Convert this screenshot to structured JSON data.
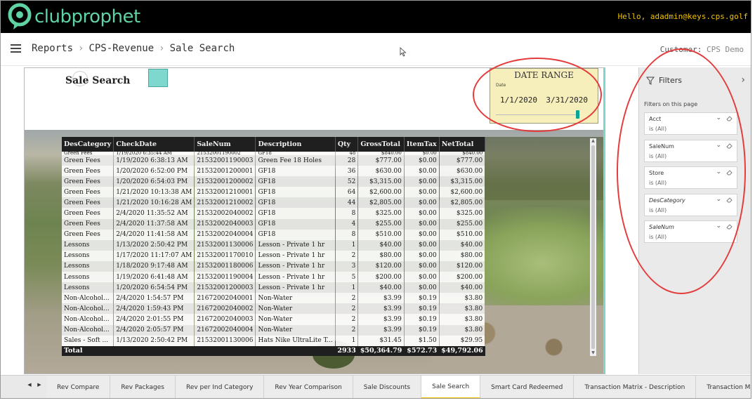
{
  "app": {
    "logo_text": "clubprophet",
    "greeting": "Hello, adadmin@keys.cps.golf",
    "brand_color": "#5fd3a3",
    "greeting_color": "#f2c200"
  },
  "nav": {
    "breadcrumbs": [
      "Reports",
      "CPS-Revenue",
      "Sale Search"
    ],
    "customer_label": "Customer:",
    "customer_value": "CPS Demo"
  },
  "report": {
    "title": "Sale Search",
    "date_slicer": {
      "title": "DATE RANGE",
      "label": "Date",
      "start": "1/1/2020",
      "end": "3/31/2020",
      "accent": "#0ba596"
    },
    "table": {
      "columns": [
        "DesCategory",
        "CheckDate",
        "SaleNum",
        "Description",
        "Qty",
        "GrossTotal",
        "ItemTax",
        "NetTotal"
      ],
      "partial_row": [
        "Green Fees",
        "1/19/2020 6:35:44 AM",
        "21532001190002",
        "GF18",
        "48",
        "$840.00",
        "$0.00",
        "$840.00"
      ],
      "rows": [
        [
          "Green Fees",
          "1/19/2020 6:38:13 AM",
          "21532001190003",
          "Green Fee 18 Holes",
          "28",
          "$777.00",
          "$0.00",
          "$777.00"
        ],
        [
          "Green Fees",
          "1/20/2020 6:52:00 PM",
          "21532001200001",
          "GF18",
          "36",
          "$630.00",
          "$0.00",
          "$630.00"
        ],
        [
          "Green Fees",
          "1/20/2020 6:54:03 PM",
          "21532001200002",
          "GF18",
          "52",
          "$3,315.00",
          "$0.00",
          "$3,315.00"
        ],
        [
          "Green Fees",
          "1/21/2020 10:13:38 AM",
          "21532001210001",
          "GF18",
          "64",
          "$2,600.00",
          "$0.00",
          "$2,600.00"
        ],
        [
          "Green Fees",
          "1/21/2020 10:16:28 AM",
          "21532001210002",
          "GF18",
          "44",
          "$2,805.00",
          "$0.00",
          "$2,805.00"
        ],
        [
          "Green Fees",
          "2/4/2020 11:35:52 AM",
          "21532002040002",
          "GF18",
          "8",
          "$325.00",
          "$0.00",
          "$325.00"
        ],
        [
          "Green Fees",
          "2/4/2020 11:37:58 AM",
          "21532002040003",
          "GF18",
          "4",
          "$255.00",
          "$0.00",
          "$255.00"
        ],
        [
          "Green Fees",
          "2/4/2020 11:41:58 AM",
          "21532002040004",
          "GF18",
          "8",
          "$510.00",
          "$0.00",
          "$510.00"
        ],
        [
          "Lessons",
          "1/13/2020 2:50:42 PM",
          "21532001130006",
          "Lesson - Private 1 hr",
          "1",
          "$40.00",
          "$0.00",
          "$40.00"
        ],
        [
          "Lessons",
          "1/17/2020 11:17:07 AM",
          "21532001170010",
          "Lesson - Private 1 hr",
          "2",
          "$80.00",
          "$0.00",
          "$80.00"
        ],
        [
          "Lessons",
          "1/18/2020 9:17:48 AM",
          "21532001180006",
          "Lesson - Private 1 hr",
          "3",
          "$120.00",
          "$0.00",
          "$120.00"
        ],
        [
          "Lessons",
          "1/19/2020 6:41:48 AM",
          "21532001190004",
          "Lesson - Private 1 hr",
          "5",
          "$200.00",
          "$0.00",
          "$200.00"
        ],
        [
          "Lessons",
          "1/20/2020 6:54:54 PM",
          "21532001200003",
          "Lesson - Private 1 hr",
          "1",
          "$40.00",
          "$0.00",
          "$40.00"
        ],
        [
          "Non-Alcohol...",
          "2/4/2020 1:54:57 PM",
          "21672002040001",
          "Non-Water",
          "2",
          "$3.99",
          "$0.19",
          "$3.80"
        ],
        [
          "Non-Alcohol...",
          "2/4/2020 1:59:43 PM",
          "21672002040002",
          "Non-Water",
          "2",
          "$3.99",
          "$0.19",
          "$3.80"
        ],
        [
          "Non-Alcohol...",
          "2/4/2020 2:01:55 PM",
          "21672002040003",
          "Non-Water",
          "2",
          "$3.99",
          "$0.19",
          "$3.80"
        ],
        [
          "Non-Alcohol...",
          "2/4/2020 2:05:57 PM",
          "21672002040004",
          "Non-Water",
          "2",
          "$3.99",
          "$0.19",
          "$3.80"
        ],
        [
          "Sales - Soft ...",
          "1/13/2020 2:50:42 PM",
          "21532001130006",
          "Hats Nike UltraLite T...",
          "1",
          "$31.45",
          "$1.50",
          "$29.95"
        ]
      ],
      "total": {
        "label": "Total",
        "qty": "2933",
        "gross": "$50,364.79",
        "tax": "$572.73",
        "net": "$49,792.06"
      }
    }
  },
  "filters": {
    "title": "Filters",
    "subtitle": "Filters on this page",
    "items": [
      {
        "name": "Acct",
        "value": "is (All)",
        "italic": false
      },
      {
        "name": "SaleNum",
        "value": "is (All)",
        "italic": false
      },
      {
        "name": "Store",
        "value": "is (All)",
        "italic": false
      },
      {
        "name": "DesCategory",
        "value": "is (All)",
        "italic": true
      },
      {
        "name": "SaleNum",
        "value": "is (All)",
        "italic": true
      }
    ]
  },
  "tabs": {
    "items": [
      "Rev Compare",
      "Rev Packages",
      "Rev per Ind Category",
      "Rev Year Comparison",
      "Sale Discounts",
      "Sale Search",
      "Smart Card Redeemed",
      "Transaction Matrix - Description",
      "Transaction Matrix - Date"
    ],
    "active_index": 5,
    "active_color": "#f2c200"
  },
  "annotation_color": "#e43c3c"
}
